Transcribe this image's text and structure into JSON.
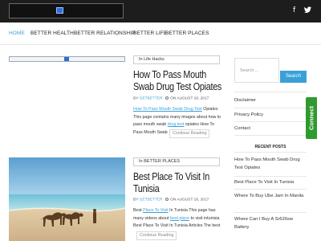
{
  "header": {
    "logo_icon": "broken-image-icon",
    "social": [
      {
        "name": "facebook-icon",
        "glyph": "f"
      },
      {
        "name": "twitter-icon",
        "glyph": "🐦"
      }
    ]
  },
  "nav": {
    "items": [
      {
        "label": "HOME",
        "active": true
      },
      {
        "label": "BETTER HEALTH"
      },
      {
        "label": "BETTER RELATIONSHIP"
      },
      {
        "label": "BETTER LIFE"
      },
      {
        "label": "BETTER PLACES"
      }
    ]
  },
  "posts": [
    {
      "category": "In Life Hacks",
      "title_line1": "How To Pass Mouth",
      "title_line2": "Swab Drug Test Opiates",
      "meta_by": "BY",
      "author": "GETBETTER",
      "meta_on": "ON AUGUST 18, 2017",
      "excerpt_link": "How To Pass Mouth Swab Drug Test",
      "excerpt_rest1": " Opiates",
      "excerpt_line2": "This page contains many images about how to",
      "excerpt_line3a": "pass mouth swab ",
      "excerpt_link2": "drug test",
      "excerpt_line3b": " opiates How To",
      "excerpt_line4": "Pass Mouth Swab",
      "read_more": "Continue Reading"
    },
    {
      "category": "In BETTER PLACES",
      "title_line1": "Best Place To Visit In",
      "title_line2": "Tunisia",
      "meta_by": "BY",
      "author": "GETBETTER",
      "meta_on": "ON AUGUST 18, 2017",
      "excerpt_a": "Best ",
      "excerpt_link": "Place To Visit",
      "excerpt_b": " In Tunisia This page has",
      "excerpt_line2a": "many videos about ",
      "excerpt_link2": "best place",
      "excerpt_line2b": " to visit intunisia",
      "excerpt_line3": "Best Place To Visit In Tunisia Articles The best",
      "read_more": "Continue Reading"
    }
  ],
  "sidebar": {
    "search_placeholder": "Search ...",
    "search_button": "Search",
    "pages": [
      "Disclaimer",
      "Privacy Policy",
      "Contact"
    ],
    "recent_title": "RECENT POSTS",
    "recent": [
      "How To Pass Mouth Swab Drug Test Opiates",
      "Best Place To Visit In Tunisia",
      "Where To Buy Ube Jam In Manila",
      "Where Can I Buy A Sr626sw Battery"
    ]
  },
  "connect_label": "Connect",
  "colors": {
    "accent": "#3aa0d8",
    "topbar": "#1d1d1d",
    "connect": "#2f9a2f"
  }
}
